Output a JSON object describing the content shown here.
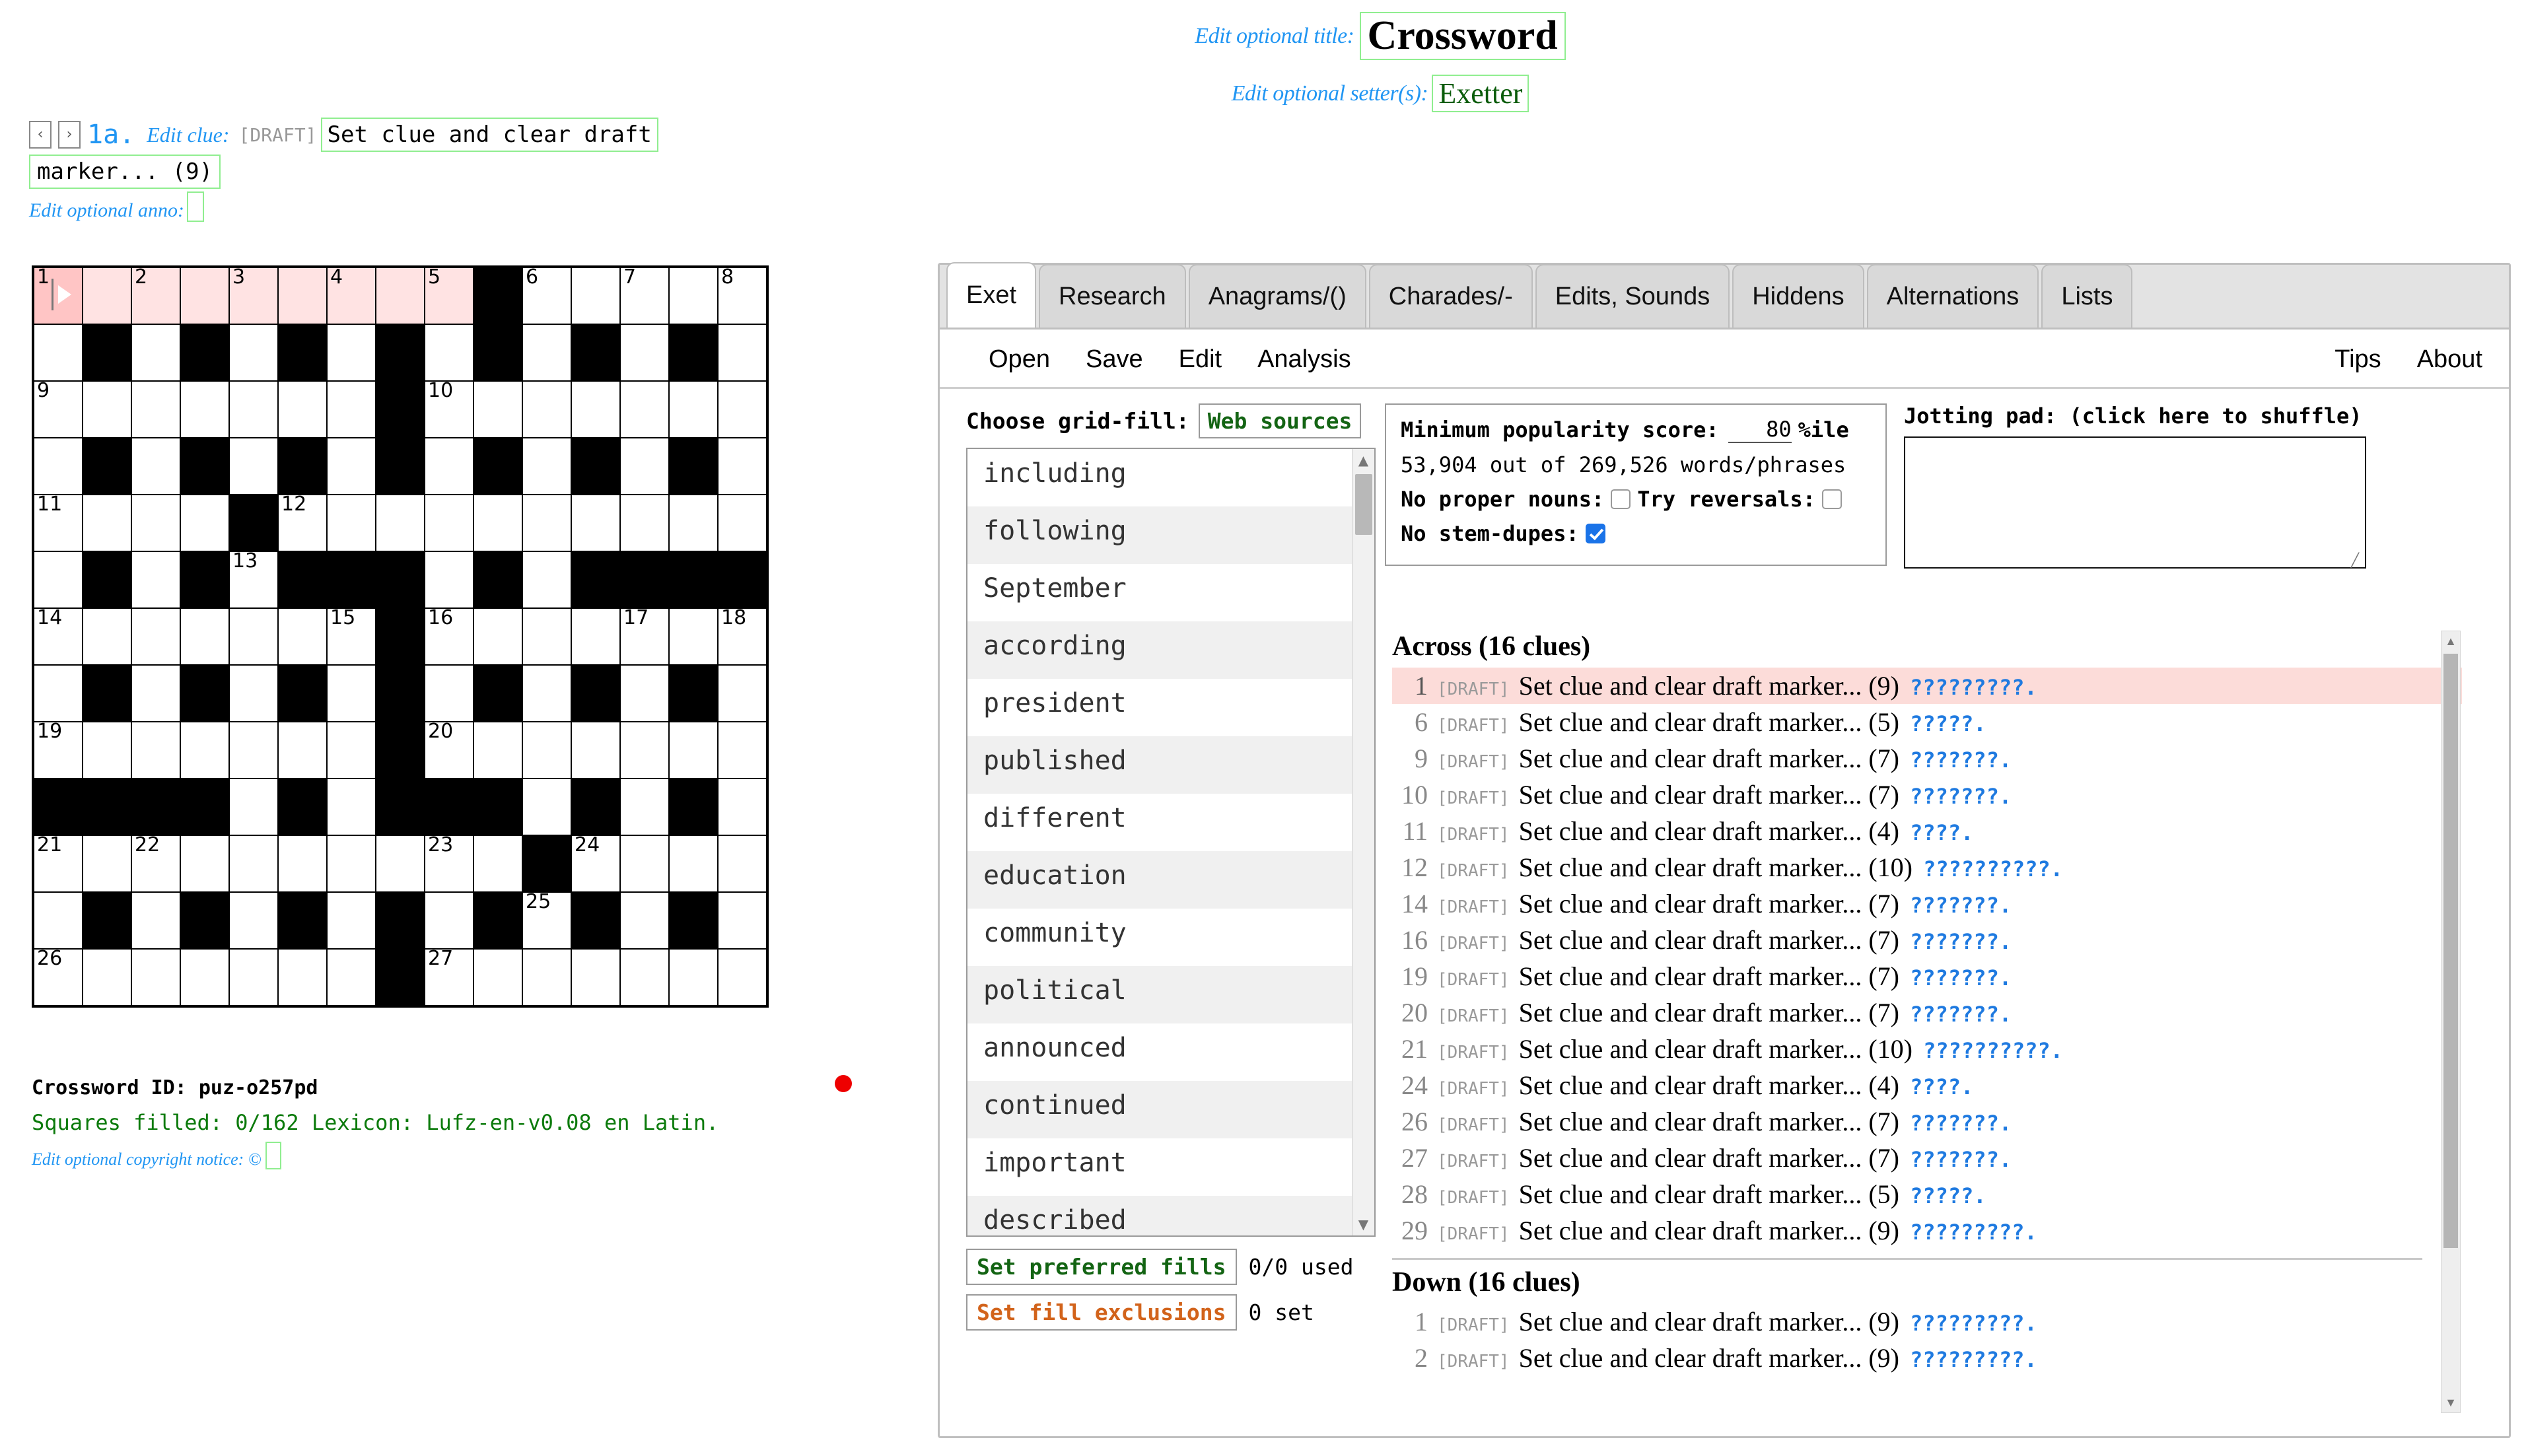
{
  "header": {
    "title_label": "Edit optional title:",
    "title_value": "Crossword",
    "setter_label": "Edit optional setter(s):",
    "setter_value": "Exetter"
  },
  "clue_editor": {
    "prev_arrow": "‹",
    "next_arrow": "›",
    "index": "1a.",
    "edit_clue_label": "Edit clue:",
    "draft_tag": "[DRAFT]",
    "clue_line1": "Set clue and clear draft",
    "clue_line2": "marker... (9)",
    "anno_label": "Edit optional anno:"
  },
  "grid_meta": {
    "crossword_id_label": "Crossword ID: puz-o257pd",
    "squares_filled": "Squares filled: 0/162 Lexicon: Lufz-en-v0.08 en Latin.",
    "copyright_label": "Edit optional copyright notice:",
    "copyright_symbol": "©",
    "status_dot_color": "#ee0000"
  },
  "tabs": [
    {
      "label": "Exet",
      "selected": true
    },
    {
      "label": "Research",
      "selected": false
    },
    {
      "label": "Anagrams/()",
      "selected": false
    },
    {
      "label": "Charades/-",
      "selected": false
    },
    {
      "label": "Edits, Sounds",
      "selected": false
    },
    {
      "label": "Hiddens",
      "selected": false
    },
    {
      "label": "Alternations",
      "selected": false
    },
    {
      "label": "Lists",
      "selected": false
    }
  ],
  "menu": {
    "left": [
      "Open",
      "Save",
      "Edit",
      "Analysis"
    ],
    "right": [
      "Tips",
      "About"
    ]
  },
  "gridfill": {
    "choose_label": "Choose grid-fill:",
    "web_sources_button": "Web sources",
    "words": [
      "including",
      "following",
      "September",
      "according",
      "president",
      "published",
      "different",
      "education",
      "community",
      "political",
      "announced",
      "continued",
      "important",
      "described"
    ],
    "preferred_fills_button": "Set preferred fills",
    "preferred_fills_note": "0/0 used",
    "fill_exclusions_button": "Set fill exclusions",
    "fill_exclusions_note": "0 set"
  },
  "options": {
    "min_pop_label": "Minimum popularity score:",
    "min_pop_value": "80",
    "min_pop_unit": "%ile",
    "counts_line": "53,904 out of 269,526 words/phrases",
    "no_proper_nouns_label": "No proper nouns:",
    "no_proper_nouns_checked": false,
    "try_reversals_label": "Try reversals:",
    "try_reversals_checked": false,
    "no_stem_dupes_label": "No stem-dupes:",
    "no_stem_dupes_checked": true,
    "checkbox_on_color": "#1a73e8"
  },
  "jotting": {
    "label": "Jotting pad: (click here to shuffle)",
    "value": ""
  },
  "clues": {
    "across_heading": "Across (16 clues)",
    "down_heading": "Down (16 clues)",
    "draft_tag": "[DRAFT]",
    "clue_text": "Set clue and clear draft marker...",
    "across": [
      {
        "num": "1",
        "enum": "(9)",
        "answer": "?????????.",
        "highlight": true
      },
      {
        "num": "6",
        "enum": "(5)",
        "answer": "?????.",
        "highlight": false
      },
      {
        "num": "9",
        "enum": "(7)",
        "answer": "???????.",
        "highlight": false
      },
      {
        "num": "10",
        "enum": "(7)",
        "answer": "???????.",
        "highlight": false
      },
      {
        "num": "11",
        "enum": "(4)",
        "answer": "????.",
        "highlight": false
      },
      {
        "num": "12",
        "enum": "(10)",
        "answer": "??????????.",
        "highlight": false
      },
      {
        "num": "14",
        "enum": "(7)",
        "answer": "???????.",
        "highlight": false
      },
      {
        "num": "16",
        "enum": "(7)",
        "answer": "???????.",
        "highlight": false
      },
      {
        "num": "19",
        "enum": "(7)",
        "answer": "???????.",
        "highlight": false
      },
      {
        "num": "20",
        "enum": "(7)",
        "answer": "???????.",
        "highlight": false
      },
      {
        "num": "21",
        "enum": "(10)",
        "answer": "??????????.",
        "highlight": false
      },
      {
        "num": "24",
        "enum": "(4)",
        "answer": "????.",
        "highlight": false
      },
      {
        "num": "26",
        "enum": "(7)",
        "answer": "???????.",
        "highlight": false
      },
      {
        "num": "27",
        "enum": "(7)",
        "answer": "???????.",
        "highlight": false
      },
      {
        "num": "28",
        "enum": "(5)",
        "answer": "?????.",
        "highlight": false
      },
      {
        "num": "29",
        "enum": "(9)",
        "answer": "?????????.",
        "highlight": false
      }
    ],
    "down": [
      {
        "num": "1",
        "enum": "(9)",
        "answer": "?????????.",
        "highlight": false
      },
      {
        "num": "2",
        "enum": "(9)",
        "answer": "?????????.",
        "highlight": false
      }
    ]
  },
  "grid": {
    "rows": 13,
    "cols": 15,
    "numbers": {
      "0,0": "1",
      "0,2": "2",
      "0,4": "3",
      "0,6": "4",
      "0,8": "5",
      "0,10": "6",
      "0,12": "7",
      "0,14": "8",
      "2,0": "9",
      "2,8": "10",
      "4,0": "11",
      "4,5": "12",
      "5,4": "13",
      "6,0": "14",
      "6,6": "15",
      "6,8": "16",
      "6,12": "17",
      "6,14": "18",
      "8,0": "19",
      "8,8": "20",
      "10,0": "21",
      "10,2": "22",
      "10,8": "23",
      "10,11": "24",
      "11,10": "25",
      "12,0": "26",
      "12,8": "27"
    },
    "black": [
      "0,9",
      "1,1",
      "1,3",
      "1,5",
      "1,7",
      "1,9",
      "1,11",
      "1,13",
      "2,7",
      "3,1",
      "3,3",
      "3,5",
      "3,7",
      "3,9",
      "3,11",
      "3,13",
      "4,4",
      "5,1",
      "5,3",
      "5,5",
      "5,6",
      "5,7",
      "5,9",
      "5,11",
      "5,12",
      "5,13",
      "5,14",
      "6,7",
      "7,1",
      "7,3",
      "7,5",
      "7,7",
      "7,9",
      "7,11",
      "7,13",
      "8,7",
      "9,0",
      "9,1",
      "9,2",
      "9,3",
      "9,5",
      "9,7",
      "9,8",
      "9,9",
      "9,11",
      "9,13",
      "10,10",
      "11,1",
      "11,3",
      "11,5",
      "11,7",
      "11,9",
      "11,11",
      "11,13",
      "12,7"
    ],
    "highlight_row": 0,
    "highlight_cols": [
      0,
      1,
      2,
      3,
      4,
      5,
      6,
      7,
      8
    ],
    "active_cell": "0,0"
  }
}
